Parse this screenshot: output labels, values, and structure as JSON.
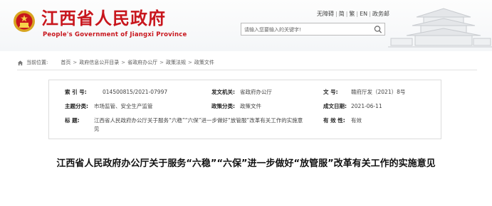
{
  "header": {
    "site_title": "江西省人民政府",
    "site_subtitle": "People's Government of Jiangxi Province",
    "top_links": [
      "无障碍",
      "简",
      "繁",
      "EN",
      "政务邮"
    ],
    "search_placeholder": "请输入您要输入的关键字!",
    "colors": {
      "brand_red": "#c8161d"
    }
  },
  "breadcrumb": {
    "label": "当前位置:",
    "items": [
      "首页",
      "政府信息公开目录",
      "省政府办公厅",
      "政策法规",
      "政策文件"
    ],
    "separator": ">"
  },
  "info": {
    "index_no_label": "索  引  号:",
    "index_no": "014500815/2021-07997",
    "issuer_label": "发文机关:",
    "issuer": "省政府办公厅",
    "doc_no_label": "文      号:",
    "doc_no": "赣府厅发（2021）8号",
    "topic_label": "主题分类:",
    "topic": "市场监管、安全生产监管",
    "category_label": "政策分类:",
    "category": "政策文件",
    "date_label": "成文日期:",
    "date": "2021-06-11",
    "title_label": "标      题:",
    "title": "江西省人民政府办公厅关于服务“六稳”“六保”进一步做好“放管服”改革有关工作的实施意见",
    "validity_label": "有 效 性:",
    "validity": "有效"
  },
  "article": {
    "title": "江西省人民政府办公厅关于服务“六稳”“六保”进一步做好“放管服”改革有关工作的实施意见"
  }
}
